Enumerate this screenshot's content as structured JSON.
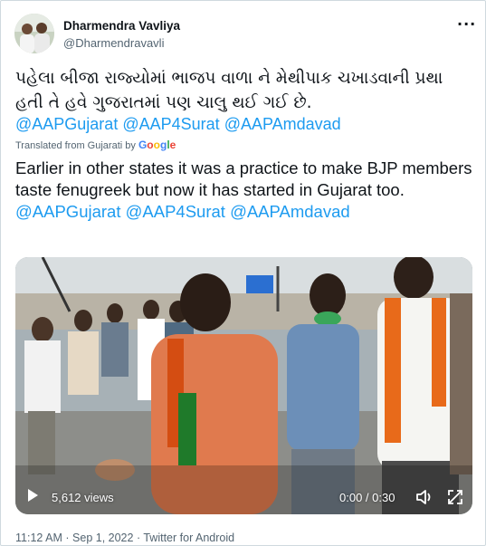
{
  "author": {
    "name": "Dharmendra Vavliya",
    "handle": "@Dharmendravavli"
  },
  "tweet": {
    "text_gujarati": "પહેલા બીજા રાજ્યોમાં ભાજપ વાળા ને મેથીપાક ચખાડવાની પ્રથા હતી તે હવે ગુજરાતમાં પણ ચાલુ થઈ ગઈ છે.",
    "mentions": [
      "@AAPGujarat",
      "@AAP4Surat",
      "@AAPAmdavad"
    ],
    "translated_label": "Translated from Gujarati by",
    "translator": "Google",
    "text_english": "Earlier in other states it was a practice to make BJP members taste fenugreek but now it has started in Gujarat too.",
    "translated_mentions": [
      "@AAPGujarat",
      "@AAP4Surat",
      "@AAPAmdavad"
    ]
  },
  "video": {
    "views": "5,612 views",
    "time": "0:00 / 0:30"
  },
  "footer": {
    "time": "11:12 AM",
    "sep1": "·",
    "date": "Sep 1, 2022",
    "sep2": "·",
    "source": "Twitter for Android"
  },
  "colors": {
    "link": "#1d9bf0",
    "muted": "#536471",
    "text": "#0f1419"
  },
  "icons": [
    "more-icon",
    "play-icon",
    "volume-icon",
    "fullscreen-icon"
  ]
}
